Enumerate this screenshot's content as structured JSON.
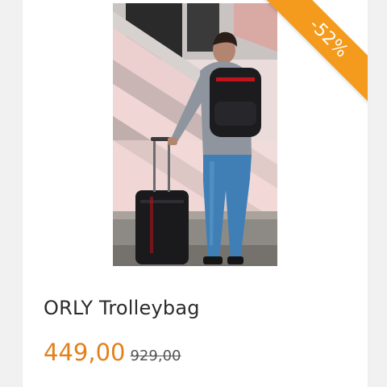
{
  "product": {
    "title": "ORLY Trolleybag",
    "price": "449,00",
    "old_price": "929,00",
    "discount_badge": "-52%"
  },
  "colors": {
    "accent": "#e3801c",
    "badge": "#f49a1c"
  },
  "image": {
    "icon": "product-photo"
  }
}
